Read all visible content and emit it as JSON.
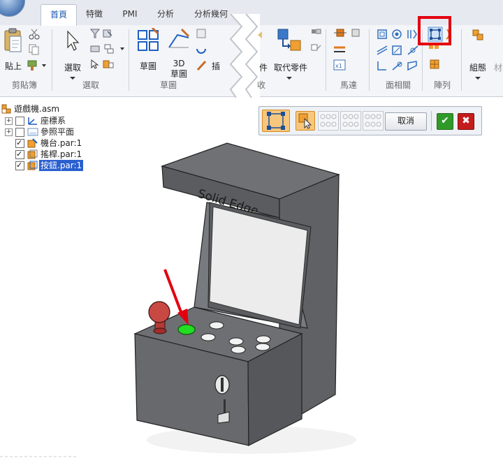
{
  "ribbon": {
    "tabs": [
      {
        "label": "首頁",
        "active": true
      },
      {
        "label": "特徵",
        "active": false
      },
      {
        "label": "PMI",
        "active": false
      },
      {
        "label": "分析",
        "active": false
      },
      {
        "label": "分析幾何",
        "active": false
      }
    ],
    "buttons": {
      "paste": "貼上",
      "select": "選取",
      "sketch": "草圖",
      "sketch3d_line1": "3D",
      "sketch3d_line2": "草圖",
      "insert_partial": "插",
      "replace_part_partial": "件",
      "replace_part": "取代零件",
      "group": "組態"
    },
    "groups": {
      "clipboard": "剪貼簿",
      "select": "選取",
      "sketch": "草圖",
      "collect_partial": "收",
      "motor": "馬達",
      "face_relate": "面相關",
      "pattern": "陣列",
      "far_right_partial": "材"
    }
  },
  "tree": {
    "items": [
      {
        "label": "遊戲機.asm",
        "level": 0,
        "expander": false,
        "checkbox": false,
        "checked": false,
        "selected": false
      },
      {
        "label": "座標系",
        "level": 1,
        "expander": true,
        "checkbox": true,
        "checked": false,
        "selected": false
      },
      {
        "label": "參照平面",
        "level": 1,
        "expander": true,
        "checkbox": true,
        "checked": false,
        "selected": false
      },
      {
        "label": "機台.par:1",
        "level": 1,
        "expander": false,
        "checkbox": true,
        "checked": true,
        "selected": false
      },
      {
        "label": "搖桿.par:1",
        "level": 1,
        "expander": false,
        "checkbox": true,
        "checked": true,
        "selected": false
      },
      {
        "label": "按鈕.par:1",
        "level": 1,
        "expander": false,
        "checkbox": true,
        "checked": true,
        "selected": true
      }
    ]
  },
  "command_bar": {
    "cancel": "取消",
    "accept_icon": "checkmark-icon",
    "close_icon": "close-icon"
  },
  "model": {
    "brand_text": "Solid Edge"
  },
  "colors": {
    "highlight_box": "#e3000f",
    "arrow": "#e3000f",
    "selected_button": "#22dd22",
    "cabinet": "#6b6d70",
    "tree_selection": "#2a5fcf"
  }
}
